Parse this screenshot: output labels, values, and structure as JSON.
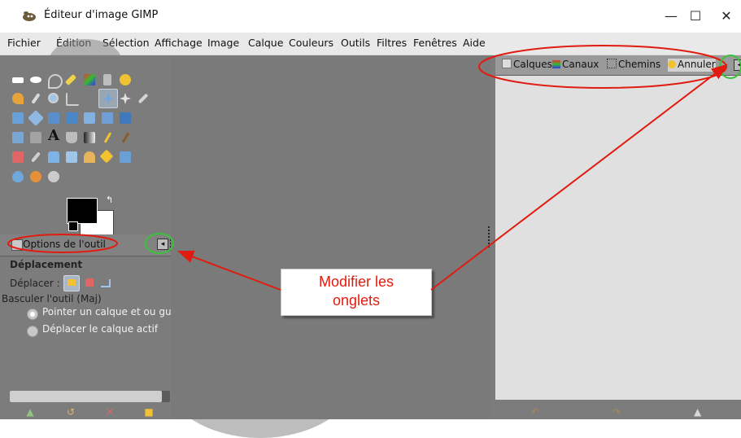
{
  "window": {
    "title": "Éditeur d'image GIMP",
    "minimize": "—",
    "maximize": "☐",
    "close": "✕"
  },
  "menu": [
    "Fichier",
    "Édition",
    "Sélection",
    "Affichage",
    "Image",
    "Calque",
    "Couleurs",
    "Outils",
    "Filtres",
    "Fenêtres",
    "Aide"
  ],
  "tool_options": {
    "tab_label": "Options de l'outil",
    "menu_button": "◂",
    "tool_name": "Déplacement",
    "move_label": "Déplacer :",
    "toggle_label": "Basculer l'outil  (Maj)",
    "radio_1": "Pointer un calque et ou gu",
    "radio_2": "Déplacer le calque actif",
    "progress_fraction": 0.95
  },
  "right_panel": {
    "tabs": [
      "Calques",
      "Canaux",
      "Chemins",
      "Annuler"
    ],
    "menu_button": "◂"
  },
  "callout": {
    "line1": "Modifier les",
    "line2": "onglets"
  },
  "colors": {
    "annotation_red": "#e11b0f",
    "highlight_green": "#39c33a"
  },
  "icons": {
    "left_bottom": [
      "save-icon",
      "undo-icon",
      "delete-icon",
      "reset-icon"
    ],
    "right_bottom": [
      "undo-icon",
      "redo-icon",
      "clear-history-icon"
    ]
  }
}
